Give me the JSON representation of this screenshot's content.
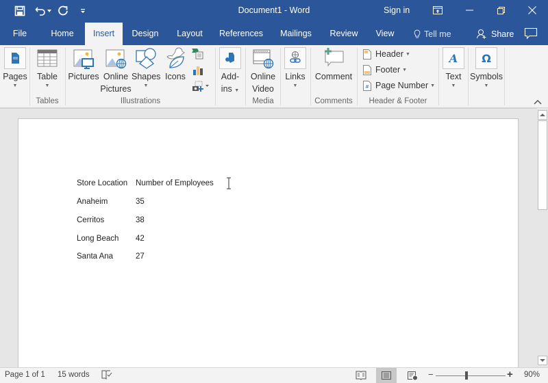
{
  "app": {
    "title": "Document1  -  Word",
    "sign_in": "Sign in"
  },
  "quick_access": {
    "save": "save-icon",
    "undo": "undo-icon",
    "undo_dropdown": "chevron-down-icon",
    "redo": "redo-icon",
    "customize": "customize-qat-icon"
  },
  "window_controls": {
    "ribbon_display": "ribbon-display-icon",
    "minimize": "minimize-icon",
    "restore": "restore-icon",
    "close": "close-icon"
  },
  "tabs": [
    {
      "label": "File",
      "active": false
    },
    {
      "label": "Home",
      "active": false
    },
    {
      "label": "Insert",
      "active": true
    },
    {
      "label": "Design",
      "active": false
    },
    {
      "label": "Layout",
      "active": false
    },
    {
      "label": "References",
      "active": false
    },
    {
      "label": "Mailings",
      "active": false
    },
    {
      "label": "Review",
      "active": false
    },
    {
      "label": "View",
      "active": false
    }
  ],
  "tell_me": "Tell me",
  "share": "Share",
  "ribbon": {
    "groups": [
      {
        "label": "Tables"
      },
      {
        "label": "Illustrations"
      },
      {
        "label": "Media"
      },
      {
        "label": "Comments"
      },
      {
        "label": "Header & Footer"
      }
    ],
    "buttons": {
      "pages": "Pages",
      "table": "Table",
      "pictures": "Pictures",
      "online_pictures_1": "Online",
      "online_pictures_2": "Pictures",
      "shapes": "Shapes",
      "icons": "Icons",
      "addins_1": "Add-",
      "addins_2": "ins",
      "online_video_1": "Online",
      "online_video_2": "Video",
      "links": "Links",
      "comment": "Comment",
      "header": "Header",
      "footer": "Footer",
      "page_number": "Page Number",
      "text": "Text",
      "symbols": "Symbols"
    }
  },
  "document": {
    "headers": [
      "Store Location",
      "Number of Employees"
    ],
    "rows": [
      [
        "Anaheim",
        "35"
      ],
      [
        "Cerritos",
        "38"
      ],
      [
        "Long Beach",
        "42"
      ],
      [
        "Santa Ana",
        "27"
      ]
    ]
  },
  "status": {
    "page": "Page 1 of 1",
    "words": "15 words",
    "zoom": "90%",
    "zoom_minus": "−",
    "zoom_plus": "+",
    "zoom_level_percent": 90,
    "active_view": "print-layout"
  },
  "colors": {
    "brand": "#2b579a",
    "ribbon_bg": "#f3f3f3",
    "canvas_bg": "#e6e6e6",
    "icon_blue": "#2e75b6"
  }
}
